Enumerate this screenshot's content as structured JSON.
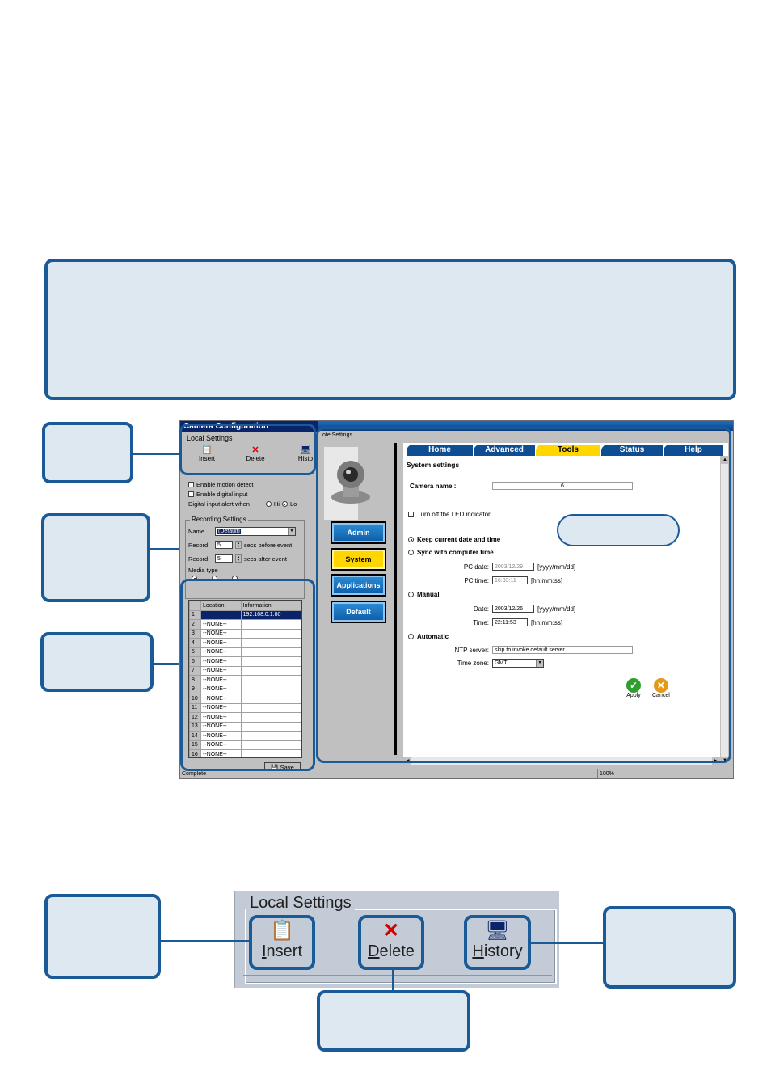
{
  "app": {
    "window_title": "Camera Configuration",
    "local_settings_label": "Local Settings",
    "toolbar": {
      "insert": "Insert",
      "delete": "Delete",
      "history": "Histo"
    },
    "checks": {
      "motion_detect": "Enable motion detect",
      "digital_input": "Enable digital input",
      "alert_when": "Digital input alert when",
      "alert_hi": "Hi",
      "alert_lo": "Lo"
    },
    "recording": {
      "label": "Recording Settings",
      "name_label": "Name",
      "name_value": "(Default)",
      "record_label_1": "Record",
      "record_value_1": "5",
      "record_suffix_1": "secs before event",
      "record_label_2": "Record",
      "record_value_2": "5",
      "record_suffix_2": "secs after event",
      "media_type_label": "Media type"
    },
    "grid": {
      "headers": [
        "Location",
        "Information"
      ],
      "rows": [
        {
          "n": "1",
          "loc": "",
          "info": "192.168.0.1:80"
        },
        {
          "n": "2",
          "loc": "--NONE--",
          "info": ""
        },
        {
          "n": "3",
          "loc": "--NONE--",
          "info": ""
        },
        {
          "n": "4",
          "loc": "--NONE--",
          "info": ""
        },
        {
          "n": "5",
          "loc": "--NONE--",
          "info": ""
        },
        {
          "n": "6",
          "loc": "--NONE--",
          "info": ""
        },
        {
          "n": "7",
          "loc": "--NONE--",
          "info": ""
        },
        {
          "n": "8",
          "loc": "--NONE--",
          "info": ""
        },
        {
          "n": "9",
          "loc": "--NONE--",
          "info": ""
        },
        {
          "n": "10",
          "loc": "--NONE--",
          "info": ""
        },
        {
          "n": "11",
          "loc": "--NONE--",
          "info": ""
        },
        {
          "n": "12",
          "loc": "--NONE--",
          "info": ""
        },
        {
          "n": "13",
          "loc": "--NONE--",
          "info": ""
        },
        {
          "n": "14",
          "loc": "--NONE--",
          "info": ""
        },
        {
          "n": "15",
          "loc": "--NONE--",
          "info": ""
        },
        {
          "n": "16",
          "loc": "--NONE--",
          "info": ""
        }
      ]
    },
    "save_label": "Save",
    "status_left": "Complete",
    "status_right": "100%",
    "remote_label": "ote Settings",
    "nav": {
      "admin": "Admin",
      "system": "System",
      "applications": "Applications",
      "default": "Default"
    },
    "tabs": {
      "home": "Home",
      "advanced": "Advanced",
      "tools": "Tools",
      "status": "Status",
      "help": "Help"
    },
    "system": {
      "title": "System settings",
      "camera_name_label": "Camera name :",
      "camera_name_value": "6",
      "led_label": "Turn off the LED indicator",
      "keep_time": "Keep current date and time",
      "sync_time": "Sync with computer time",
      "pc_date_label": "PC date:",
      "pc_date_value": "2003/12/29",
      "pc_date_fmt": "[yyyy/mm/dd]",
      "pc_time_label": "PC time:",
      "pc_time_value": "16:33:11",
      "pc_time_fmt": "[hh:mm:ss]",
      "manual": "Manual",
      "date_label": "Date:",
      "date_value": "2003/12/26",
      "date_fmt": "[yyyy/mm/dd]",
      "time_label": "Time:",
      "time_value": "22:11:53",
      "time_fmt": "[hh:mm:ss]",
      "automatic": "Automatic",
      "ntp_label": "NTP server:",
      "ntp_value": "skip to invoke default server",
      "tz_label": "Time zone:",
      "tz_value": "GMT",
      "apply": "Apply",
      "cancel": "Cancel"
    }
  },
  "zoom": {
    "label": "Local Settings",
    "insert_u": "I",
    "insert_rest": "nsert",
    "delete_u": "D",
    "delete_rest": "elete",
    "history_u": "H",
    "history_rest": "istory"
  },
  "colors": {
    "accent": "#1a5a96",
    "callout_fill": "#dde8f1",
    "nav_blue": "#0d5aa6",
    "tab_blue": "#0e4d91",
    "tab_active": "#ffd600"
  }
}
